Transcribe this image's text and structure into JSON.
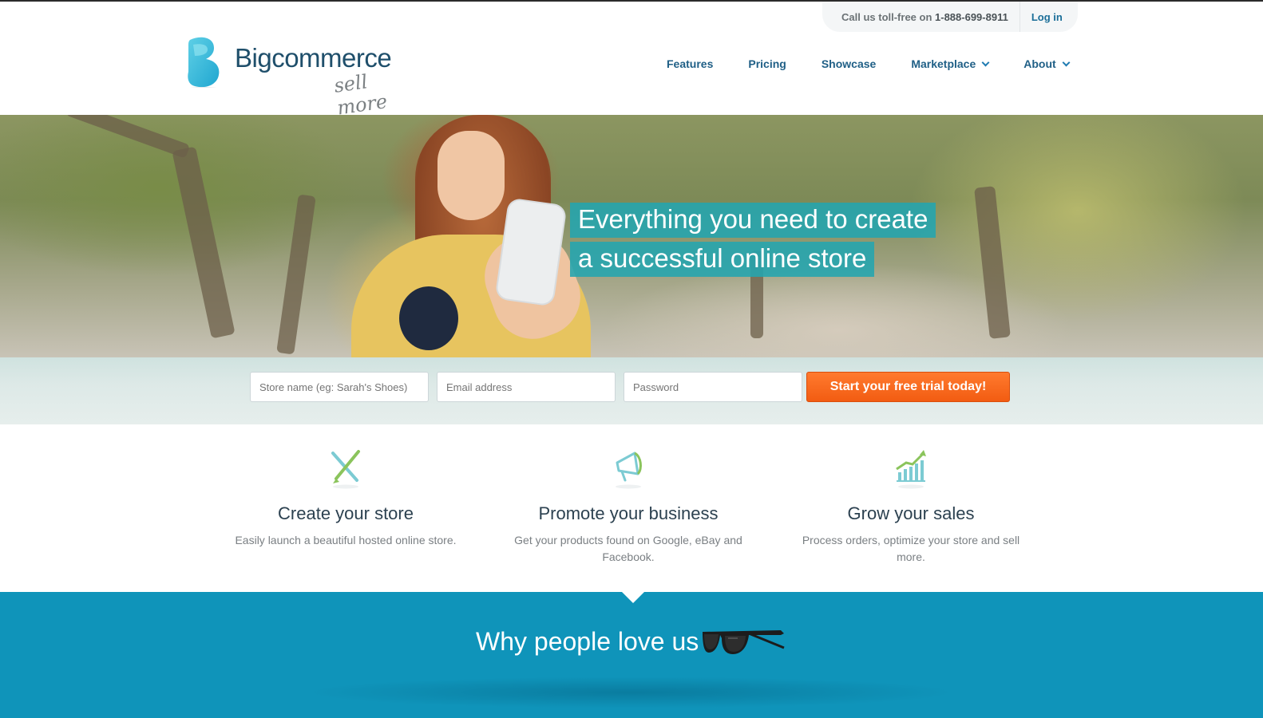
{
  "utility": {
    "call_prefix": "Call us toll-free on ",
    "phone": "1-888-699-8911",
    "login": "Log in"
  },
  "logo": {
    "name": "Bigcommerce",
    "tagline": "sell more"
  },
  "nav": [
    {
      "label": "Features"
    },
    {
      "label": "Pricing"
    },
    {
      "label": "Showcase"
    },
    {
      "label": "Marketplace"
    },
    {
      "label": "About"
    }
  ],
  "hero": {
    "line1": "Everything you need to create",
    "line2": "a successful online store"
  },
  "signup": {
    "store_placeholder": "Store name (eg: Sarah's Shoes)",
    "email_placeholder": "Email address",
    "password_placeholder": "Password",
    "cta": "Start your free trial today!"
  },
  "features": [
    {
      "icon": "design-tools-icon",
      "title": "Create your store",
      "desc": "Easily launch a beautiful hosted online store."
    },
    {
      "icon": "megaphone-icon",
      "title": "Promote your business",
      "desc": "Get your products found on Google, eBay and Facebook."
    },
    {
      "icon": "growth-chart-icon",
      "title": "Grow your sales",
      "desc": "Process orders, optimize your store and sell more."
    }
  ],
  "why": {
    "title": "Why people love us",
    "icon": "sunglasses-icon"
  },
  "colors": {
    "brand_blue": "#1f5f86",
    "teal_band": "#0f94ba",
    "cta_orange": "#f25c12",
    "hero_highlight": "#23a5af"
  }
}
